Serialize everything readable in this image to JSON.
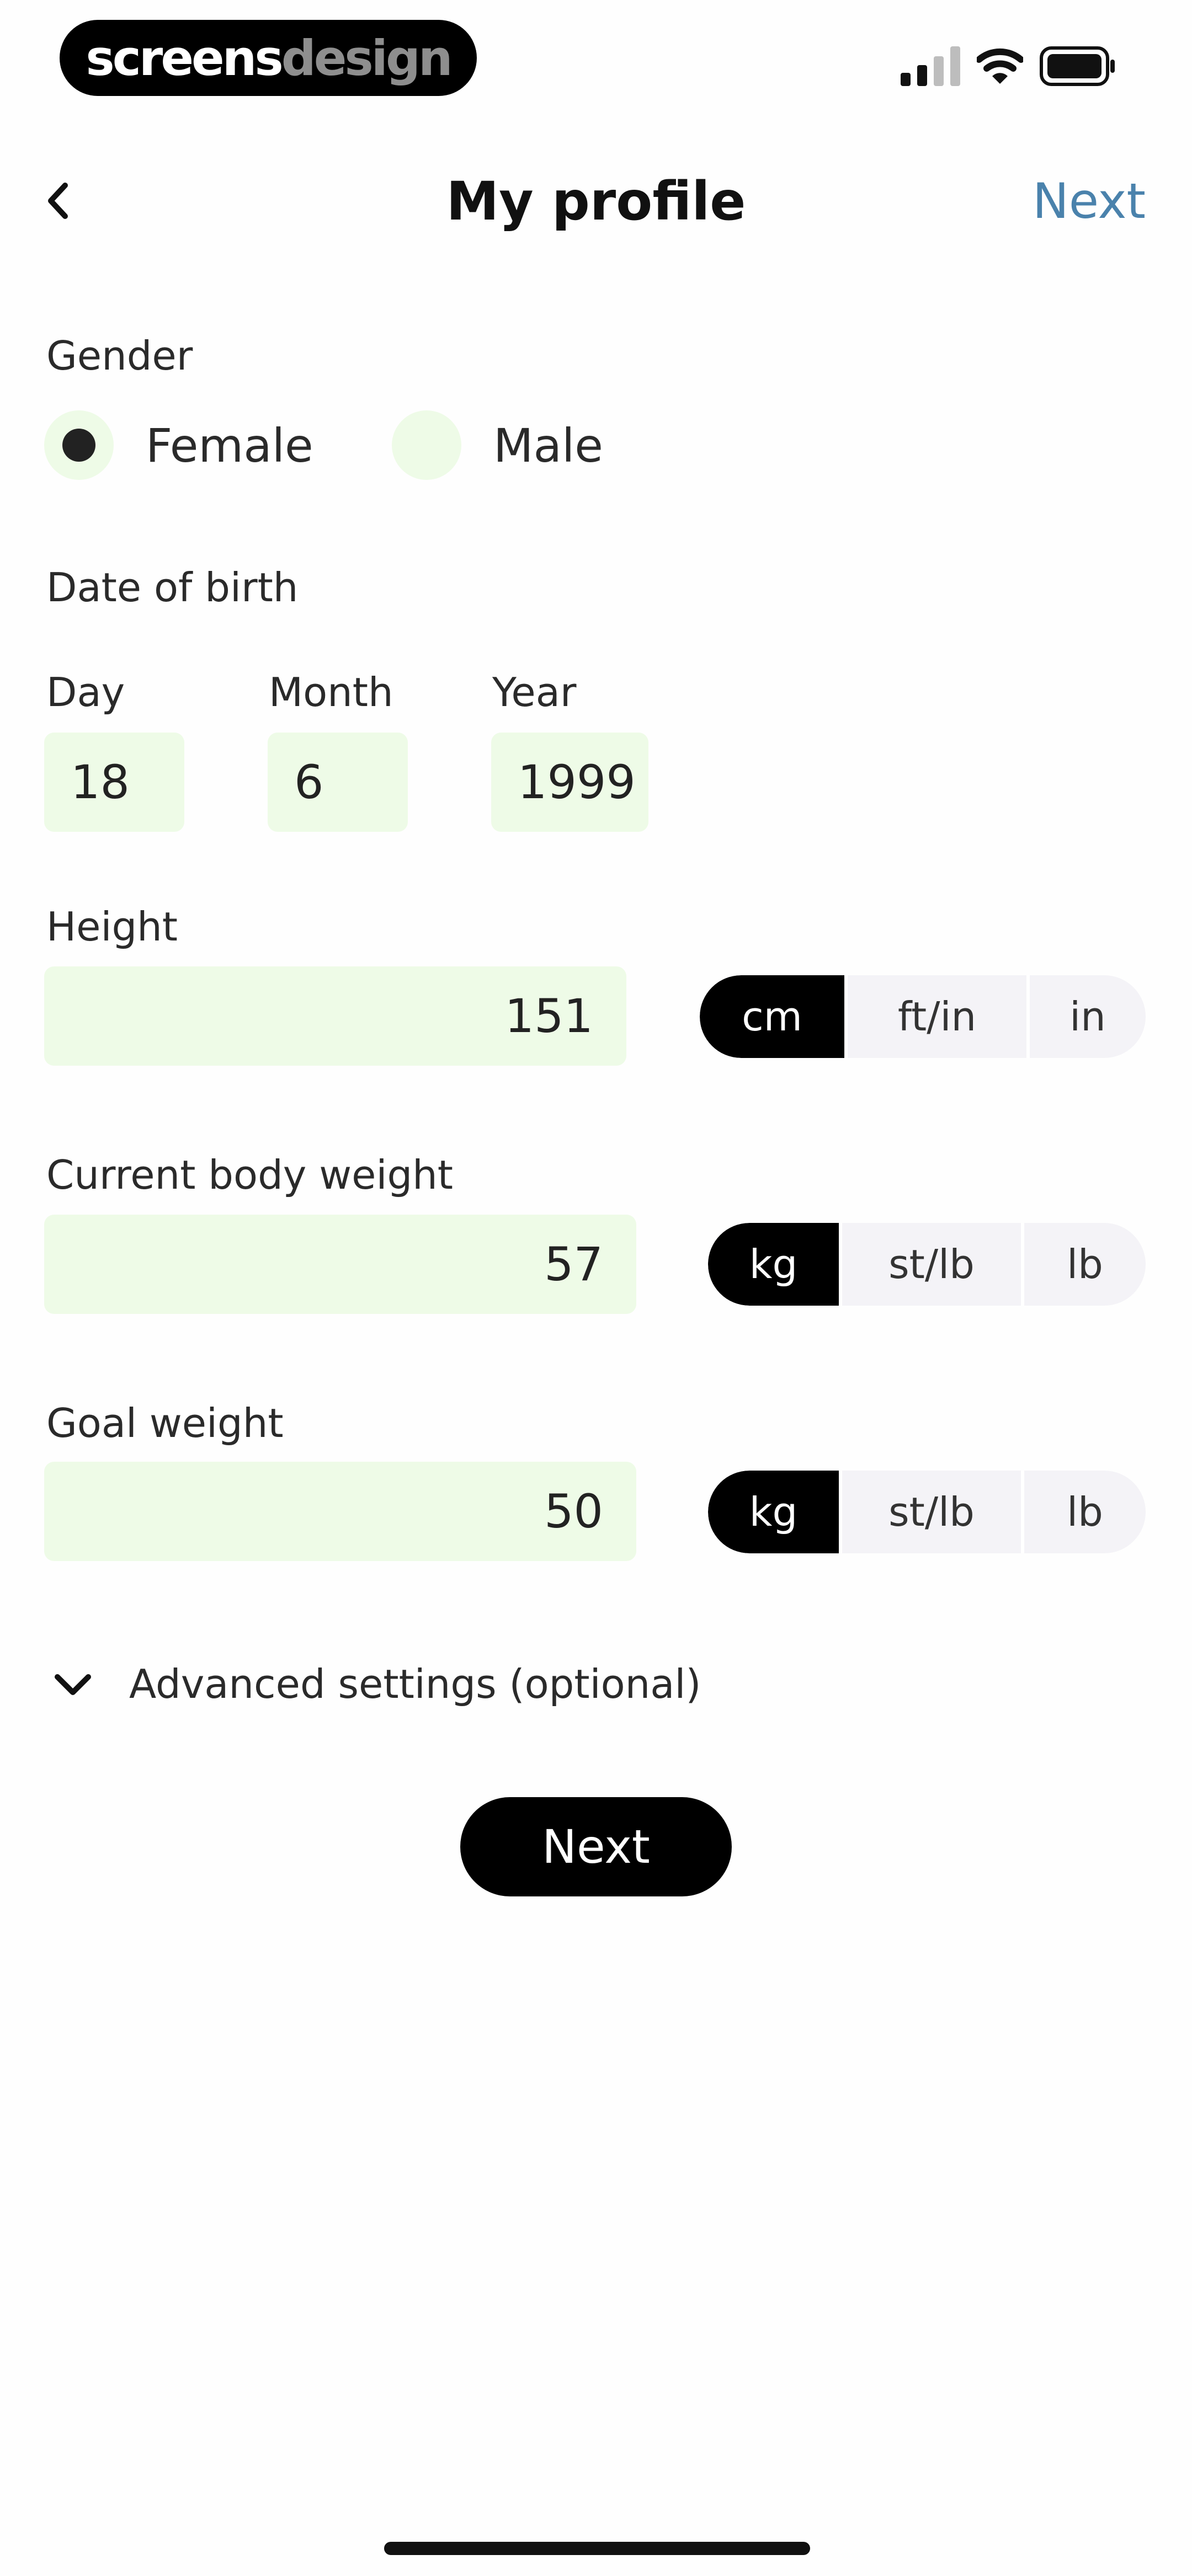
{
  "status_bar": {
    "brand_part1": "screens",
    "brand_part2": "design"
  },
  "header": {
    "title": "My profile",
    "next_label": "Next"
  },
  "gender": {
    "label": "Gender",
    "options": [
      {
        "label": "Female",
        "selected": true
      },
      {
        "label": "Male",
        "selected": false
      }
    ]
  },
  "dob": {
    "label": "Date of birth",
    "day_label": "Day",
    "day_value": "18",
    "month_label": "Month",
    "month_value": "6",
    "year_label": "Year",
    "year_value": "1999"
  },
  "height": {
    "label": "Height",
    "value": "151",
    "units": [
      "cm",
      "ft/in",
      "in"
    ],
    "selected_unit": "cm"
  },
  "current_weight": {
    "label": "Current body weight",
    "value": "57",
    "units": [
      "kg",
      "st/lb",
      "lb"
    ],
    "selected_unit": "kg"
  },
  "goal_weight": {
    "label": "Goal weight",
    "value": "50",
    "units": [
      "kg",
      "st/lb",
      "lb"
    ],
    "selected_unit": "kg"
  },
  "advanced": {
    "label": "Advanced settings (optional)"
  },
  "footer": {
    "next_label": "Next"
  },
  "colors": {
    "accent_field": "#eefbe7",
    "link": "#4a82ac",
    "primary": "#000000"
  }
}
